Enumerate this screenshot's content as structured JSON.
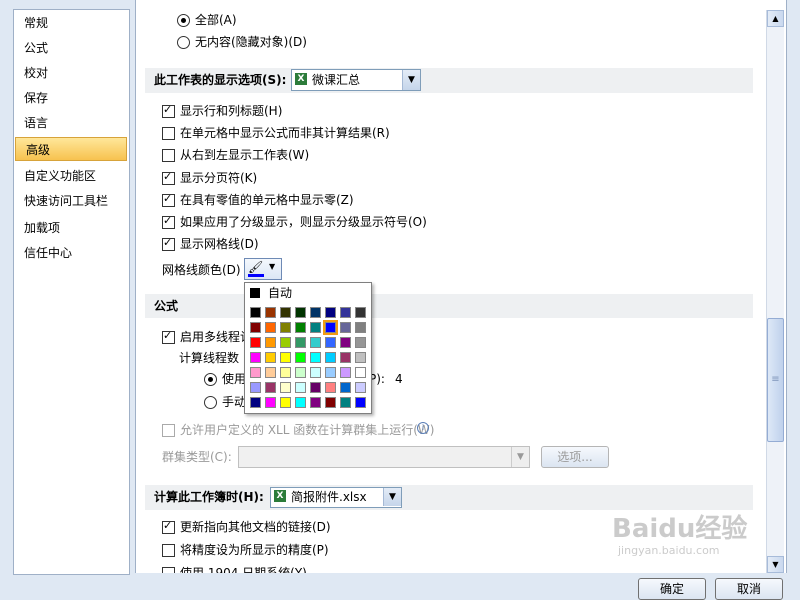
{
  "nav": {
    "items": [
      {
        "label": "常规"
      },
      {
        "label": "公式"
      },
      {
        "label": "校对"
      },
      {
        "label": "保存"
      },
      {
        "label": "语言"
      },
      {
        "label": "高级",
        "selected": true
      },
      {
        "label": "自定义功能区"
      },
      {
        "label": "快速访问工具栏"
      },
      {
        "label": "加载项"
      },
      {
        "label": "信任中心"
      }
    ]
  },
  "top": {
    "radio_all": "全部(A)",
    "radio_none": "无内容(隐藏对象)(D)"
  },
  "sheet_section": {
    "title": "此工作表的显示选项(S):",
    "combo_value": "微课汇总",
    "options": [
      {
        "label": "显示行和列标题(H)",
        "checked": true
      },
      {
        "label": "在单元格中显示公式而非其计算结果(R)",
        "checked": false
      },
      {
        "label": "从右到左显示工作表(W)",
        "checked": false
      },
      {
        "label": "显示分页符(K)",
        "checked": true
      },
      {
        "label": "在具有零值的单元格中显示零(Z)",
        "checked": true
      },
      {
        "label": "如果应用了分级显示，则显示分级显示符号(O)",
        "checked": true
      },
      {
        "label": "显示网格线(D)",
        "checked": true
      }
    ],
    "gridline_color_label": "网格线颜色(D)"
  },
  "palette": {
    "auto_label": "自动",
    "rows": [
      [
        "#000000",
        "#993300",
        "#333300",
        "#003300",
        "#003366",
        "#000080",
        "#333399",
        "#333333"
      ],
      [
        "#800000",
        "#FF6600",
        "#808000",
        "#008000",
        "#008080",
        "#0000FF",
        "#666699",
        "#808080"
      ],
      [
        "#FF0000",
        "#FF9900",
        "#99CC00",
        "#339966",
        "#33CCCC",
        "#3366FF",
        "#800080",
        "#969696"
      ],
      [
        "#FF00FF",
        "#FFCC00",
        "#FFFF00",
        "#00FF00",
        "#00FFFF",
        "#00CCFF",
        "#993366",
        "#C0C0C0"
      ],
      [
        "#FF99CC",
        "#FFCC99",
        "#FFFF99",
        "#CCFFCC",
        "#CCFFFF",
        "#99CCFF",
        "#CC99FF",
        "#FFFFFF"
      ],
      [
        "#9999FF",
        "#993366",
        "#FFFFCC",
        "#CCFFFF",
        "#660066",
        "#FF8080",
        "#0066CC",
        "#CCCCFF"
      ],
      [
        "#000080",
        "#FF00FF",
        "#FFFF00",
        "#00FFFF",
        "#800080",
        "#800000",
        "#008080",
        "#0000FF"
      ]
    ],
    "selected": [
      1,
      5
    ]
  },
  "formula_section": {
    "title": "公式",
    "multithread_label": "启用多线程计",
    "threads_label": "计算线程数",
    "use_label": "使用",
    "use_suffix": "P):",
    "use_value": "4",
    "manual_label": "手动",
    "xll_label": "允许用户定义的 XLL 函数在计算群集上运行(W)",
    "cluster_label": "群集类型(C):",
    "options_button": "选项..."
  },
  "workbook_section": {
    "title": "计算此工作簿时(H):",
    "combo_value": "简报附件.xlsx",
    "options": [
      {
        "label": "更新指向其他文档的链接(D)",
        "checked": true
      },
      {
        "label": "将精度设为所显示的精度(P)",
        "checked": false
      },
      {
        "label": "使用 1904 日期系统(Y)",
        "checked": false
      }
    ]
  },
  "buttons": {
    "ok": "确定",
    "cancel": "取消"
  },
  "watermark": {
    "text": "Baidu经验",
    "url": "jingyan.baidu.com"
  },
  "colors": {
    "selected_nav": "#f7c24f",
    "section_bg": "#eef0f2"
  }
}
